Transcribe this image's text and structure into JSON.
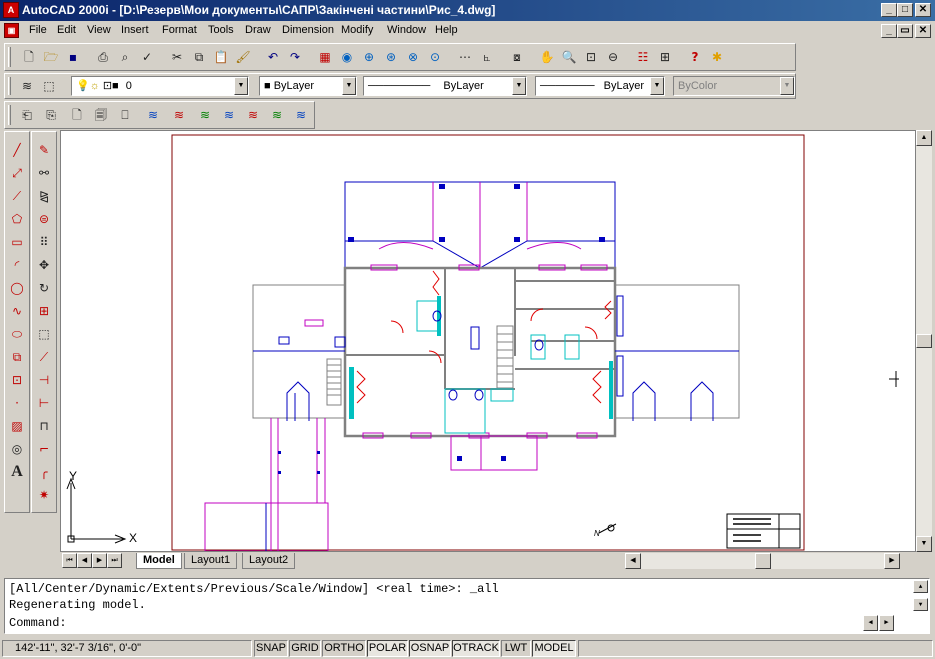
{
  "window": {
    "title": "AutoCAD 2000i - [D:\\Резерв\\Мои документы\\САПР\\Закінчені частини\\Рис_4.dwg]",
    "app_icon_text": "A"
  },
  "menu": [
    "File",
    "Edit",
    "View",
    "Insert",
    "Format",
    "Tools",
    "Draw",
    "Dimension",
    "Modify",
    "Window",
    "Help"
  ],
  "layer_bar": {
    "layer_name": "0",
    "color": "ByLayer",
    "linetype": "ByLayer",
    "lineweight": "ByLayer",
    "plot_style": "ByColor"
  },
  "layout_tabs": [
    "Model",
    "Layout1",
    "Layout2"
  ],
  "active_tab": "Model",
  "ucs": {
    "x_label": "X",
    "y_label": "Y"
  },
  "north": {
    "label": "N"
  },
  "command": {
    "line1": "[All/Center/Dynamic/Extents/Previous/Scale/Window] <real time>: _all",
    "line2": "Regenerating model.",
    "prompt": "Command:"
  },
  "status": {
    "coords": "142'-11\",   32'-7 3/16\", 0'-0\"",
    "toggles": [
      {
        "label": "SNAP",
        "on": false
      },
      {
        "label": "GRID",
        "on": false
      },
      {
        "label": "ORTHO",
        "on": false
      },
      {
        "label": "POLAR",
        "on": true
      },
      {
        "label": "OSNAP",
        "on": true
      },
      {
        "label": "OTRACK",
        "on": true
      },
      {
        "label": "LWT",
        "on": false
      },
      {
        "label": "MODEL",
        "on": true
      }
    ]
  },
  "colors": {
    "titlebar": "#0a246a",
    "plan_wall": "#808080",
    "plan_blue": "#0000c0",
    "plan_magenta": "#c000c0",
    "plan_cyan": "#00c0c0",
    "plan_red": "#e00000",
    "sheet_border": "#800000"
  }
}
